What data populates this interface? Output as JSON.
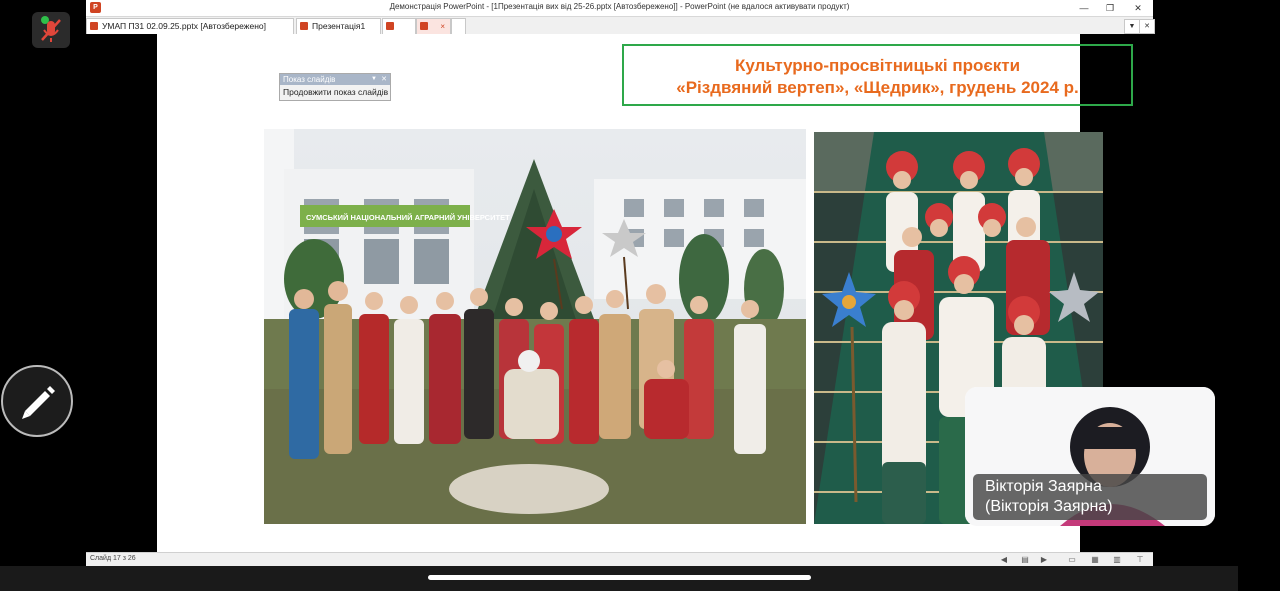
{
  "window": {
    "title": "Демонстрація PowerPoint - [1Презентація вих від 25-26.pptx [Автозбережено]] - PowerPoint (не вдалося активувати продукт)",
    "logo_letter": "P",
    "minimize": "—",
    "restore": "❐",
    "close": "✕"
  },
  "tabs": [
    {
      "label": "УМАП П31 02.09.25.pptx [Автозбережено]"
    },
    {
      "label": "Презентація1"
    },
    {
      "label": "",
      "close": "×"
    }
  ],
  "tab_controls": {
    "dropdown": "▼",
    "close": "✕"
  },
  "slide": {
    "title_line1": "Культурно-просвітницькі проєкти",
    "title_line2": "«Різдвяний вертеп», «Щедрик», грудень 2024 р.",
    "photo1_sign": "СУМСЬКИЙ НАЦІОНАЛЬНИЙ АГРАРНИЙ УНІВЕРСИТЕТ"
  },
  "slideshow_toolbar": {
    "title": "Показ слайдів",
    "dropdown": "▼",
    "close": "✕",
    "action": "Продовжити показ слайдів"
  },
  "statusbar": {
    "slide_counter": "Слайд 17 з 26"
  },
  "participant": {
    "name_line1": "Вікторія Заярна",
    "name_line2": "(Вікторія Заярна)"
  },
  "colors": {
    "title_text": "#e86a1e",
    "title_border": "#2ea84a",
    "ppt_accent": "#d04423"
  }
}
